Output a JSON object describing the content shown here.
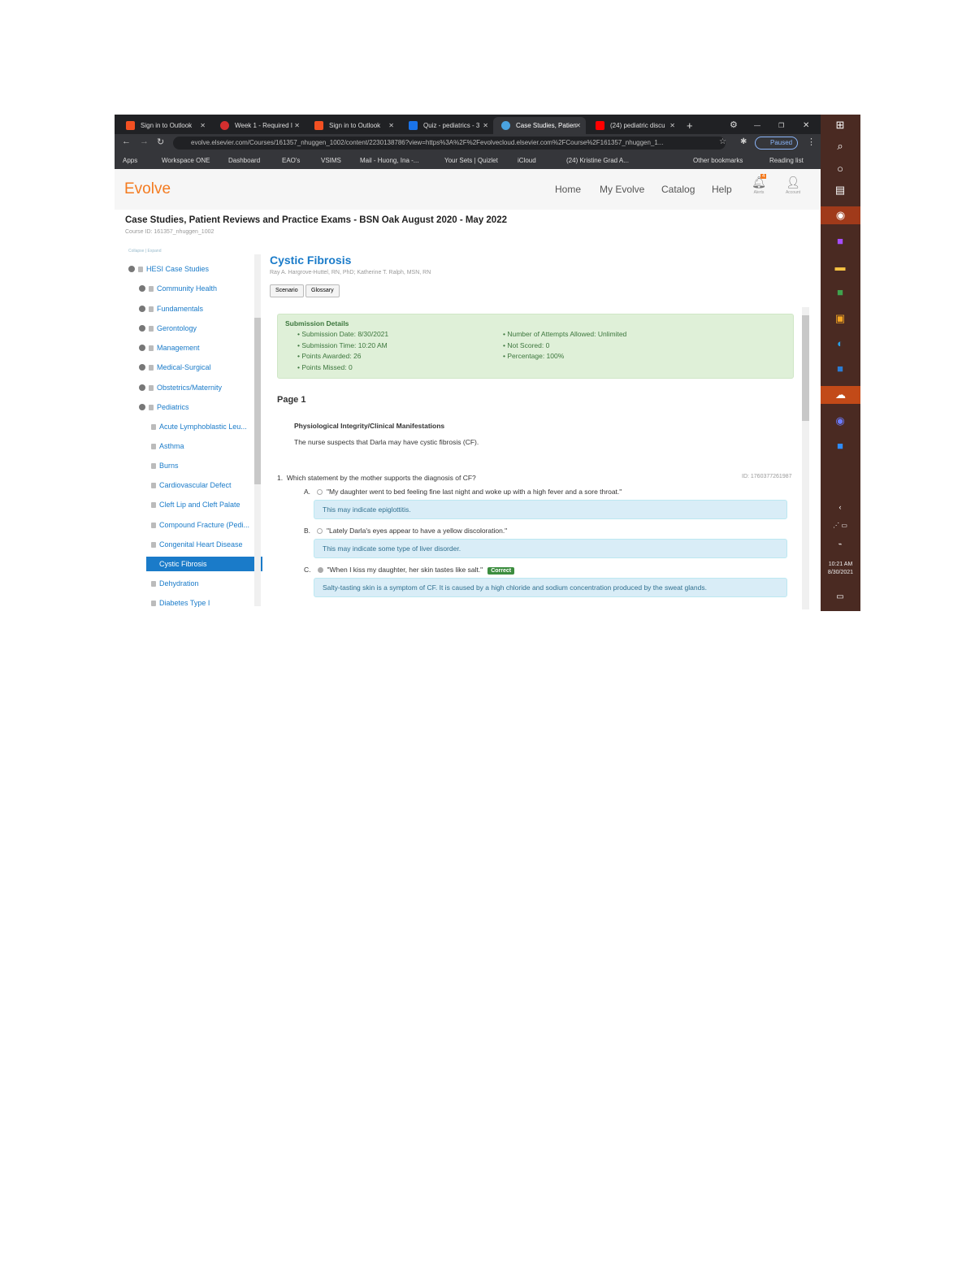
{
  "browser": {
    "tabs": [
      {
        "label": "Sign in to Outlook",
        "color": "#f25022"
      },
      {
        "label": "Week 1 - Required I",
        "color": "#d32f2f"
      },
      {
        "label": "Sign in to Outlook",
        "color": "#f25022"
      },
      {
        "label": "Quiz - pediatrics - 3",
        "color": "#1a73e8"
      },
      {
        "label": "Case Studies, Patien",
        "color": "#4aa3df",
        "active": true
      },
      {
        "label": "(24) pediatric discu",
        "color": "#ff0000"
      }
    ],
    "url": "evolve.elsevier.com/Courses/161357_nhuggen_1002/content/2230138786?view=https%3A%2F%2Fevolvecloud.elsevier.com%2FCourse%2F161357_nhuggen_1...",
    "profile_label": "Paused",
    "bookmarks": [
      "Apps",
      "Workspace ONE",
      "Dashboard",
      "EAO's",
      "VSIMS",
      "Mail - Huong, Ina -...",
      "Your Sets | Quizlet",
      "iCloud",
      "(24) Kristine Grad A..."
    ],
    "other_bookmarks": "Other bookmarks",
    "reading_list": "Reading list"
  },
  "header": {
    "logo": "Evolve",
    "nav": [
      "Home",
      "My Evolve",
      "Catalog",
      "Help"
    ],
    "alert_count": "4",
    "alerts_label": "Alerts",
    "account_label": "Account"
  },
  "course": {
    "title": "Case Studies, Patient Reviews and Practice Exams - BSN Oak August 2020 - May 2022",
    "id": "Course ID: 161357_nhuggen_1002"
  },
  "sidebar": {
    "collapse_all": "Collapse | Expand",
    "items": [
      {
        "label": "HESI Case Studies",
        "level": 0,
        "toggle": true
      },
      {
        "label": "Community Health",
        "level": 1,
        "toggle": true
      },
      {
        "label": "Fundamentals",
        "level": 1,
        "toggle": true
      },
      {
        "label": "Gerontology",
        "level": 1,
        "toggle": true
      },
      {
        "label": "Management",
        "level": 1,
        "toggle": true
      },
      {
        "label": "Medical-Surgical",
        "level": 1,
        "toggle": true
      },
      {
        "label": "Obstetrics/Maternity",
        "level": 1,
        "toggle": true
      },
      {
        "label": "Pediatrics",
        "level": 1,
        "toggle": true
      },
      {
        "label": "Acute Lymphoblastic Leu...",
        "level": 2
      },
      {
        "label": "Asthma",
        "level": 2
      },
      {
        "label": "Burns",
        "level": 2
      },
      {
        "label": "Cardiovascular Defect",
        "level": 2
      },
      {
        "label": "Cleft Lip and Cleft Palate",
        "level": 2
      },
      {
        "label": "Compound Fracture (Pedi...",
        "level": 2
      },
      {
        "label": "Congenital Heart Disease",
        "level": 2
      },
      {
        "label": "Cystic Fibrosis",
        "level": 2,
        "selected": true
      },
      {
        "label": "Dehydration",
        "level": 2
      },
      {
        "label": "Diabetes Type I",
        "level": 2
      }
    ]
  },
  "main": {
    "title": "Cystic Fibrosis",
    "authors": "Ray A. Hargrove-Huttel, RN, PhD; Katherine T. Ralph, MSN, RN",
    "buttons": [
      "Scenario",
      "Glossary"
    ],
    "submission": {
      "heading": "Submission Details",
      "left": [
        "Submission Date: 8/30/2021",
        "Submission Time: 10:20 AM",
        "Points Awarded: 26",
        "Points Missed: 0"
      ],
      "right": [
        "Number of Attempts Allowed: Unlimited",
        "Not Scored: 0",
        "Percentage: 100%"
      ]
    },
    "page_label": "Page 1",
    "section": "Physiological Integrity/Clinical Manifestations",
    "stem": "The nurse suspects that Darla may have cystic fibrosis (CF).",
    "question": {
      "number": "1.",
      "text": "Which statement by the mother supports the diagnosis of CF?",
      "id": "ID: 1760377261987",
      "options": [
        {
          "letter": "A.",
          "text": "\"My daughter went to bed feeling fine last night and woke up with a high fever and a sore throat.\"",
          "feedback": "This may indicate epiglottitis."
        },
        {
          "letter": "B.",
          "text": "\"Lately Darla's eyes appear to have a yellow discoloration.\"",
          "feedback": "This may indicate some type of liver disorder."
        },
        {
          "letter": "C.",
          "text": "\"When I kiss my daughter, her skin tastes like salt.\"",
          "feedback": "Salty-tasting skin is a symptom of CF. It is caused by a high chloride and sodium concentration produced by the sweat glands.",
          "badge": "Correct",
          "selected": true
        }
      ]
    }
  },
  "taskbar": {
    "time": "10:21 AM",
    "date": "8/30/2021"
  },
  "colors": {
    "accent": "#1a7bc9",
    "brand": "#f47b20",
    "success_bg": "#dff0d8",
    "info_bg": "#d9edf7",
    "taskbar": "#4a2a22"
  }
}
